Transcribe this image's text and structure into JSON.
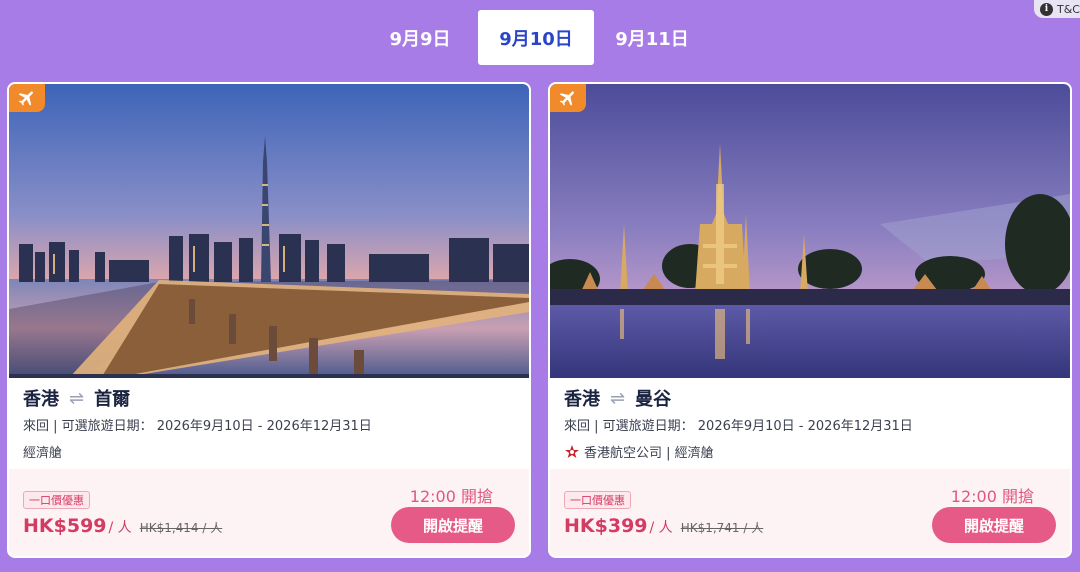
{
  "tnc": {
    "label": "T&C",
    "icon": "info-icon"
  },
  "tabs": [
    {
      "label": "9月9日",
      "active": false
    },
    {
      "label": "9月10日",
      "active": true
    },
    {
      "label": "9月11日",
      "active": false
    }
  ],
  "cards": [
    {
      "from": "香港",
      "to": "首爾",
      "detail": "來回 | 可選旅遊日期： 2026年9月10日 - 2026年12月31日",
      "cabin": "經濟艙",
      "tag": "一口價優惠",
      "price": "HK$599",
      "per": "/ 人",
      "old_price": "HK$1,414 / 人",
      "sale_time": "12:00 開搶",
      "button": "開啟提醒"
    },
    {
      "from": "香港",
      "to": "曼谷",
      "detail": "來回 | 可選旅遊日期： 2026年9月10日 - 2026年12月31日",
      "cabin": "香港航空公司 | 經濟艙",
      "tag": "一口價優惠",
      "price": "HK$399",
      "per": "/ 人",
      "old_price": "HK$1,741 / 人",
      "sale_time": "12:00 開搶",
      "button": "開啟提醒"
    }
  ],
  "colors": {
    "background": "#a87ce6",
    "accent": "#e65a87",
    "tab_active": "#2c45c8",
    "badge": "#f08a2a"
  }
}
